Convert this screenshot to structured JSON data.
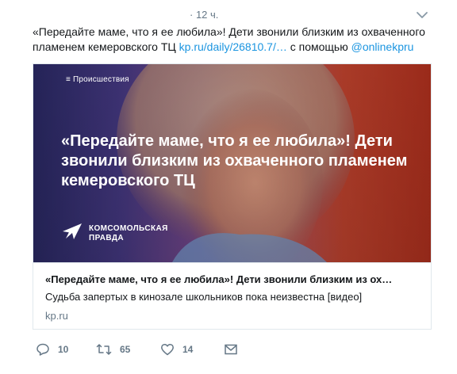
{
  "tweet": {
    "time": "· 12 ч.",
    "text_before_link": "«Передайте маме, что я ее любила»! Дети звонили близким из охваченного пламенем кемеровского ТЦ ",
    "link": "kp.ru/daily/26810.7/…",
    "text_middle": " с помощью ",
    "mention": "@onlinekpru"
  },
  "card": {
    "rubric": "≡ Происшествия",
    "headline": "«Передайте маме, что я ее любила»! Дети звонили близким из охваченного пламенем кемеровского ТЦ",
    "brand_name": "КОМСОМОЛЬСКАЯ ПРАВДА",
    "title": "«Передайте маме, что я ее любила»! Дети звонили близким из ох…",
    "description": "Судьба запертых в кинозале школьников пока неизвестна [видео]",
    "domain": "kp.ru"
  },
  "actions": {
    "reply_count": "10",
    "retweet_count": "65",
    "like_count": "14"
  },
  "icons": {
    "caret": "chevron-down-icon",
    "reply": "reply-icon",
    "retweet": "retweet-icon",
    "like": "heart-icon",
    "dm": "envelope-icon",
    "brand": "star-logo-icon"
  },
  "colors": {
    "link": "#1b95e0",
    "muted": "#657786",
    "text": "#14171a",
    "border": "#e1e8ed"
  }
}
